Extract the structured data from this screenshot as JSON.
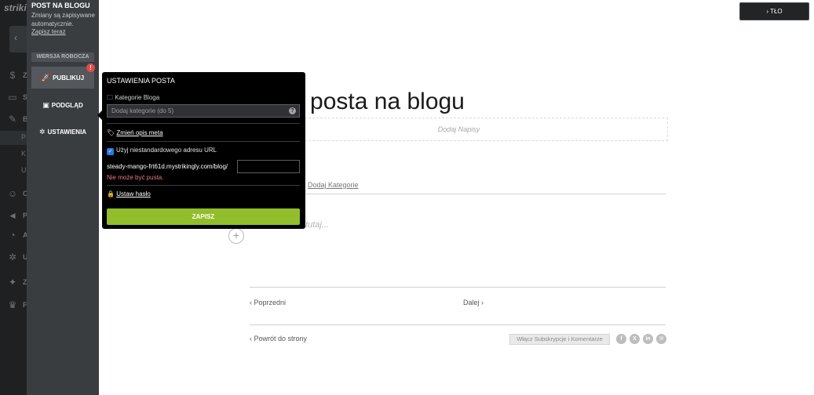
{
  "app_sidebar": {
    "logo": "strikingly",
    "back_icon": "chevron-left-icon",
    "items": [
      {
        "name": "dollar-icon",
        "glyph": "$",
        "letter": "Z"
      },
      {
        "name": "store-icon",
        "glyph": "▭",
        "letter": "S"
      },
      {
        "name": "blog-edit-icon",
        "glyph": "✎",
        "letter": "B"
      },
      {
        "name": "users-icon",
        "glyph": "☺",
        "letter": "C"
      },
      {
        "name": "megaphone-icon",
        "glyph": "◄",
        "letter": "P"
      },
      {
        "name": "analytics-icon",
        "glyph": "◔",
        "letter": "A"
      },
      {
        "name": "gear-icon",
        "glyph": "✲",
        "letter": "U"
      },
      {
        "name": "sparkle-icon",
        "glyph": "✦",
        "letter": "Z"
      },
      {
        "name": "trophy-icon",
        "glyph": "♛",
        "letter": "F"
      }
    ],
    "subitems": [
      "P",
      "K",
      "U"
    ]
  },
  "blog_panel": {
    "title": "POST NA BLOGU",
    "autosave_text": "Zmiany są zapisywane automatycznie.",
    "save_now": "Zapisz teraz",
    "draft_badge": "WERSJA ROBOCZA",
    "publish_label": "PUBLIKUJ",
    "publish_alert": "!",
    "preview_label": "PODGLĄD",
    "settings_label": "USTAWIENIA"
  },
  "post_settings": {
    "title": "USTAWIENIA POSTA",
    "category_label": "Kategorie Bloga",
    "category_placeholder": "Dodaj kategorie (do 5)",
    "help_glyph": "?",
    "meta_link": "Zmień opis meta",
    "custom_url_label": "Użyj niestandardowego adresu URL",
    "custom_url_checked": true,
    "url_prefix": "steady-mango-frt61d.mystrikingly.com/blog/",
    "url_slug": "",
    "error_text": "Nie może być pusta.",
    "password_link": "Ustaw hasło",
    "save_label": "ZAPISZ"
  },
  "top_bar": {
    "background_button": "TŁO"
  },
  "editor": {
    "title_visible": "aj tytuł posta na blogu",
    "subtitle_placeholder": "Dodaj Napisy",
    "add_category": "Dodaj Kategorie",
    "body_placeholder": "tutaj...",
    "add_block_glyph": "+",
    "prev": "Poprzedni",
    "next": "Dalej",
    "back": "Powrót do strony",
    "subscribe_button": "Włącz Subskrypcje i Komentarze",
    "social": [
      {
        "name": "facebook-icon",
        "glyph": "f"
      },
      {
        "name": "x-twitter-icon",
        "glyph": "X"
      },
      {
        "name": "linkedin-icon",
        "glyph": "in"
      },
      {
        "name": "email-icon",
        "glyph": "✉"
      }
    ]
  },
  "colors": {
    "save_green": "#93be2b",
    "error_red": "#e57b7b",
    "badge_red": "#e24b4b",
    "panel_dark": "#3a3d40",
    "popover_bg": "#000000"
  }
}
